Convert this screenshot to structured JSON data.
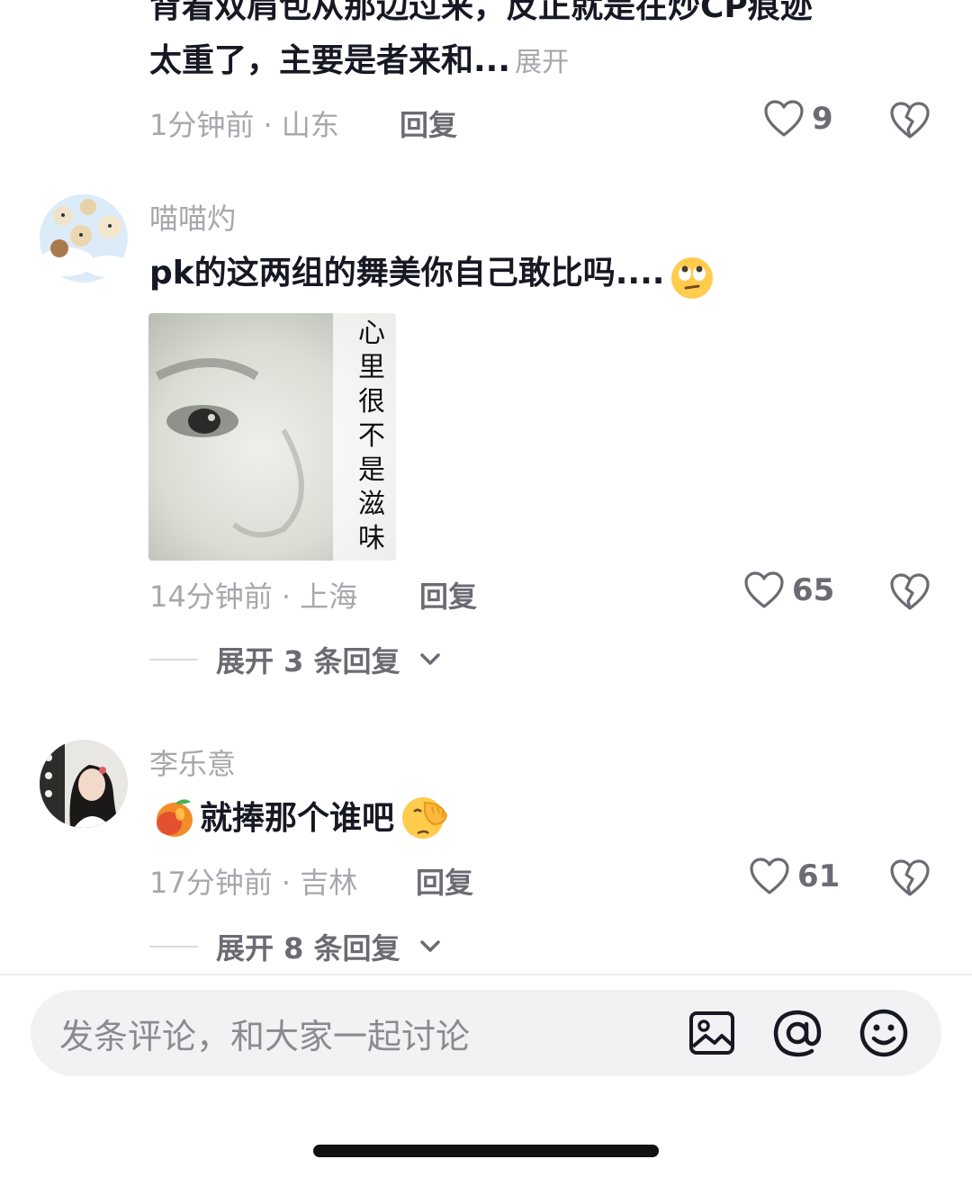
{
  "comment0": {
    "text_line1": "背着双肩包从那边过来，反正就是在炒CP痕迹",
    "text_line2": "太重了，主要是者来和...",
    "expand": "展开",
    "time_location": "1分钟前 · 山东",
    "reply": "回复",
    "likes": "9"
  },
  "comment1": {
    "username": "喵喵灼",
    "text": "pk的这两组的舞美你自己敢比吗....",
    "emoji": "face-with-rolling-eyes-emoji",
    "image_caption": [
      "心",
      "里",
      "很",
      "不",
      "是",
      "滋",
      "味"
    ],
    "time_location": "14分钟前 · 上海",
    "reply": "回复",
    "likes": "65",
    "thread": "展开 3 条回复"
  },
  "comment2": {
    "username": "李乐意",
    "text": "就捧那个谁吧",
    "emoji_leading": "mango-emoji",
    "emoji_trailing": "face-palm-emoji",
    "time_location": "17分钟前 · 吉林",
    "reply": "回复",
    "likes": "61",
    "thread": "展开 8 条回复"
  },
  "input": {
    "placeholder": "发条评论，和大家一起讨论",
    "icons": [
      "image-icon",
      "at-icon",
      "emoji-icon"
    ]
  },
  "colors": {
    "text": "#161823",
    "meta": "#a7a7ad",
    "input_bg": "#f2f2f4"
  }
}
